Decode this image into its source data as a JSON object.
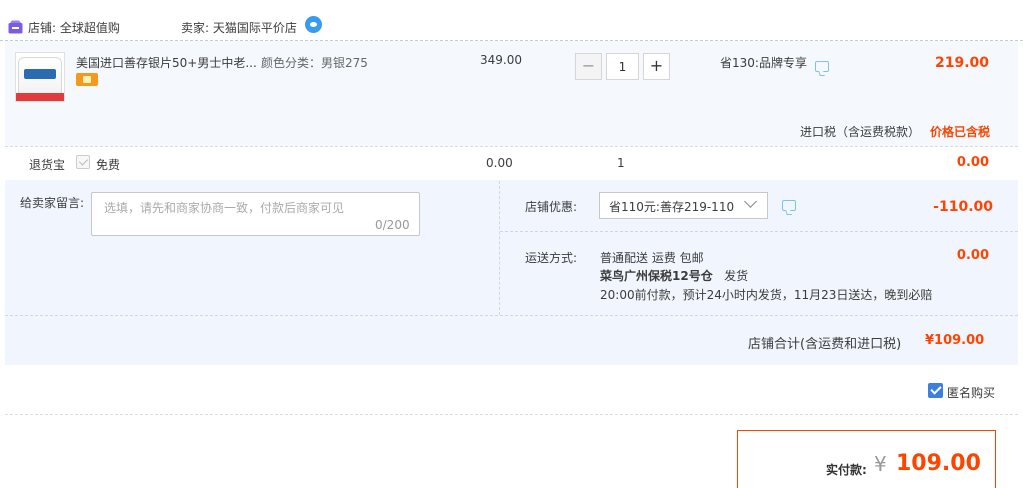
{
  "shop": {
    "store_label": "店铺: 全球超值购",
    "seller_label": "卖家: 天猫国际平价店"
  },
  "item": {
    "title": "美国进口善存银片50+男士中老...",
    "sku": "颜色分类：男银275",
    "unit_price": "349.00",
    "quantity": "1",
    "minus": "−",
    "plus": "+",
    "promo": "省130:品牌专享",
    "subtotal": "219.00",
    "tax_label": "进口税（含运费税款）",
    "tax_value": "价格已含税"
  },
  "return_insurance": {
    "label": "退货宝",
    "option": "免费",
    "price": "0.00",
    "quantity": "1",
    "subtotal": "0.00"
  },
  "message": {
    "label": "给卖家留言:",
    "placeholder": "选填，请先和商家协商一致，付款后商家可见",
    "counter": "0/200"
  },
  "coupon": {
    "label": "店铺优惠:",
    "selected": "省110元:善存219-110",
    "value": "-110.00"
  },
  "shipping": {
    "label": "运送方式:",
    "method": "普通配送 运费 包邮",
    "warehouse": "菜鸟广州保税12号仓",
    "dispatch": "发货",
    "note": "20:00前付款，预计24小时内发货，11月23日送达，晚到必赔",
    "value": "0.00"
  },
  "store_total": {
    "label": "店铺合计(含运费和进口税)",
    "value": "¥109.00"
  },
  "anonymous": {
    "label": "匿名购买",
    "checked": true
  },
  "pay": {
    "label": "实付款:",
    "currency": "¥",
    "value": "109.00"
  },
  "colors": {
    "accent": "#ff4400",
    "checkbox": "#3b80e0",
    "panel": "#f1f6fe"
  },
  "icons": [
    "store-icon",
    "wangwang-chat-icon",
    "card-badge-icon",
    "message-icon",
    "chevron-down-icon",
    "check-icon"
  ]
}
